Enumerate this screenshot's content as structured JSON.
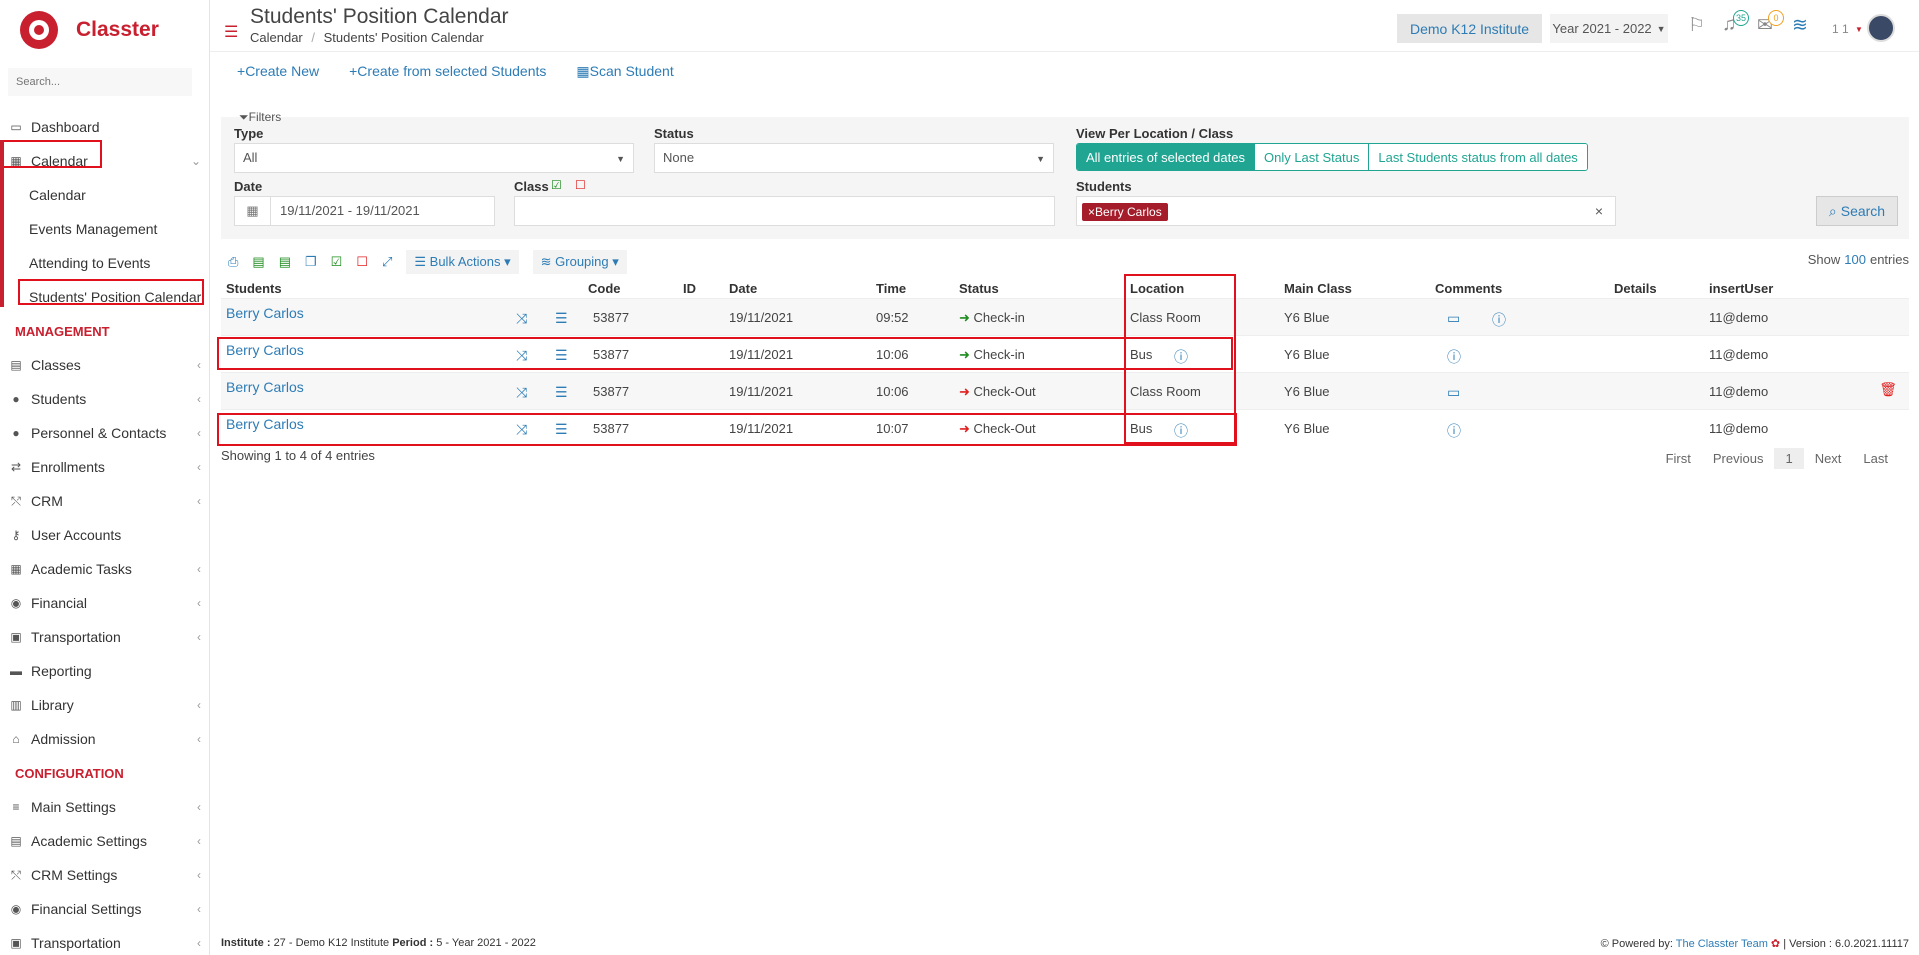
{
  "app": {
    "brand": "Classter",
    "search_placeholder": "Search..."
  },
  "sidebar": {
    "items": [
      {
        "label": "Dashboard",
        "icon": "laptop-icon"
      },
      {
        "label": "Calendar",
        "icon": "calendar-icon"
      }
    ],
    "calendar_sub": [
      "Calendar",
      "Events Management",
      "Attending to Events",
      "Students' Position Calendar"
    ],
    "management_title": "MANAGEMENT",
    "management": [
      "Classes",
      "Students",
      "Personnel & Contacts",
      "Enrollments",
      "CRM",
      "User Accounts",
      "Academic Tasks",
      "Financial",
      "Transportation",
      "Reporting",
      "Library",
      "Admission"
    ],
    "configuration_title": "CONFIGURATION",
    "configuration": [
      "Main Settings",
      "Academic Settings",
      "CRM Settings",
      "Financial Settings",
      "Transportation"
    ]
  },
  "header": {
    "title": "Students' Position Calendar",
    "breadcrumb_1": "Calendar",
    "breadcrumb_sep": "/",
    "breadcrumb_2": "Students' Position Calendar",
    "institute": "Demo K12 Institute",
    "year": "Year 2021 - 2022",
    "notifications_count": "35",
    "messages_count": "0",
    "user_label": "1 1"
  },
  "actions": {
    "create_new": "Create New",
    "create_from_selected": "Create from selected Students",
    "scan_student": "Scan Student"
  },
  "filters": {
    "title": "Filters",
    "type_label": "Type",
    "type_value": "All",
    "status_label": "Status",
    "status_value": "None",
    "view_label": "View Per Location / Class",
    "view_options": [
      "All entries of selected dates",
      "Only Last Status",
      "Last Students status from all dates"
    ],
    "date_label": "Date",
    "date_value": "19/11/2021 - 19/11/2021",
    "class_label": "Class",
    "students_label": "Students",
    "student_tag": "Berry Carlos",
    "search_label": "Search"
  },
  "toolbar": {
    "bulk_actions": "Bulk Actions",
    "grouping": "Grouping",
    "show": "Show",
    "show_count": "100",
    "entries": "entries"
  },
  "table": {
    "headers": {
      "students": "Students",
      "code": "Code",
      "id": "ID",
      "date": "Date",
      "time": "Time",
      "status": "Status",
      "location": "Location",
      "main_class": "Main Class",
      "comments": "Comments",
      "details": "Details",
      "insert_user": "insertUser"
    },
    "rows": [
      {
        "student": "Berry Carlos",
        "code": "53877",
        "date": "19/11/2021",
        "time": "09:52",
        "status": "Check-in",
        "location": "Class Room",
        "main_class": "Y6 Blue",
        "user": "11@demo"
      },
      {
        "student": "Berry Carlos",
        "code": "53877",
        "date": "19/11/2021",
        "time": "10:06",
        "status": "Check-in",
        "location": "Bus",
        "main_class": "Y6 Blue",
        "user": "11@demo"
      },
      {
        "student": "Berry Carlos",
        "code": "53877",
        "date": "19/11/2021",
        "time": "10:06",
        "status": "Check-Out",
        "location": "Class Room",
        "main_class": "Y6 Blue",
        "user": "11@demo"
      },
      {
        "student": "Berry Carlos",
        "code": "53877",
        "date": "19/11/2021",
        "time": "10:07",
        "status": "Check-Out",
        "location": "Bus",
        "main_class": "Y6 Blue",
        "user": "11@demo"
      }
    ],
    "showing": "Showing 1 to 4 of 4 entries"
  },
  "pager": {
    "first": "First",
    "previous": "Previous",
    "current": "1",
    "next": "Next",
    "last": "Last"
  },
  "footer": {
    "institute_label": "Institute :",
    "institute_value": "27 - Demo K12 Institute",
    "period_label": "Period :",
    "period_value": "5 - Year 2021 - 2022",
    "powered": "Powered by:",
    "team": "The Classter Team",
    "version": "| Version : 6.0.2021.11117"
  },
  "colors": {
    "brand": "#c8202f",
    "link": "#2d7cb5",
    "accent": "#20a592",
    "highlight": "#e0101c"
  }
}
